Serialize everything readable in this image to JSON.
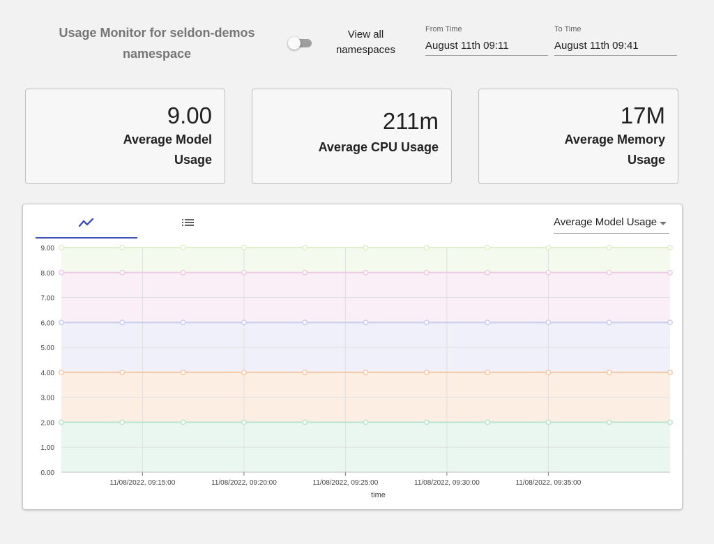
{
  "header": {
    "title_line1": "Usage Monitor for seldon-demos",
    "title_line2": "namespace",
    "toggle_label_line1": "View all",
    "toggle_label_line2": "namespaces",
    "toggle_on": false
  },
  "time_range": {
    "from_label": "From Time",
    "from_value": "August 11th 09:11",
    "to_label": "To Time",
    "to_value": "August 11th 09:41"
  },
  "stats": [
    {
      "value": "9.00",
      "label_line1": "Average Model",
      "label_line2": "Usage"
    },
    {
      "value": "211m",
      "label_line1": "Average CPU Usage",
      "label_line2": ""
    },
    {
      "value": "17M",
      "label_line1": "Average Memory",
      "label_line2": "Usage"
    }
  ],
  "chart_panel": {
    "tabs": [
      {
        "icon": "line-chart-icon",
        "active": true
      },
      {
        "icon": "list-icon",
        "active": false
      }
    ],
    "metric_selected": "Average Model Usage"
  },
  "chart_data": {
    "type": "area",
    "stacked": true,
    "xlabel": "time",
    "ylabel": "",
    "ylim": [
      0,
      9
    ],
    "yticks": [
      "0.00",
      "1.00",
      "2.00",
      "3.00",
      "4.00",
      "5.00",
      "6.00",
      "7.00",
      "8.00",
      "9.00"
    ],
    "xticks": [
      "11/08/2022, 09:15:00",
      "11/08/2022, 09:20:00",
      "11/08/2022, 09:25:00",
      "11/08/2022, 09:30:00",
      "11/08/2022, 09:35:00"
    ],
    "x": [
      "09:11",
      "09:14",
      "09:17",
      "09:20",
      "09:23",
      "09:26",
      "09:29",
      "09:32",
      "09:35",
      "09:38",
      "09:41"
    ],
    "grid": true,
    "series": [
      {
        "values": [
          2,
          2,
          2,
          2,
          2,
          2,
          2,
          2,
          2,
          2,
          2
        ],
        "color": "#b9e4cf"
      },
      {
        "values": [
          2,
          2,
          2,
          2,
          2,
          2,
          2,
          2,
          2,
          2,
          2
        ],
        "color": "#f7c7a3"
      },
      {
        "values": [
          2,
          2,
          2,
          2,
          2,
          2,
          2,
          2,
          2,
          2,
          2
        ],
        "color": "#c9cdef"
      },
      {
        "values": [
          2,
          2,
          2,
          2,
          2,
          2,
          2,
          2,
          2,
          2,
          2
        ],
        "color": "#eec8e6"
      },
      {
        "values": [
          1,
          1,
          1,
          1,
          1,
          1,
          1,
          1,
          1,
          1,
          1
        ],
        "color": "#dff0c8"
      }
    ]
  }
}
